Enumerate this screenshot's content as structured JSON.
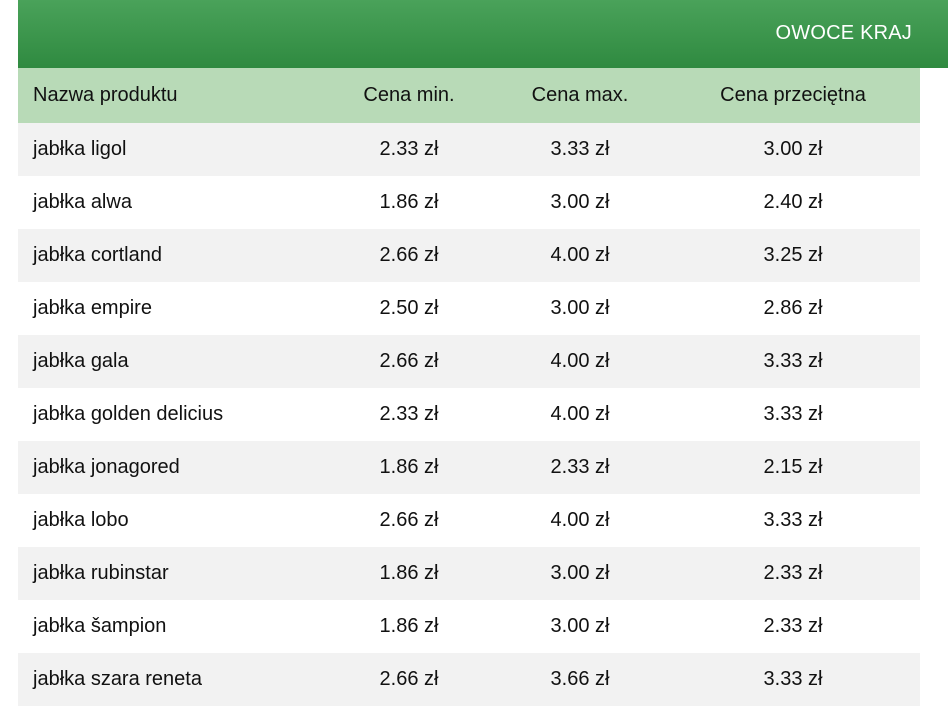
{
  "banner": {
    "title": "OWOCE KRAJ"
  },
  "table": {
    "headers": {
      "name": "Nazwa produktu",
      "min": "Cena min.",
      "max": "Cena max.",
      "avg": "Cena przeciętna"
    },
    "rows": [
      {
        "name": "jabłka ligol",
        "min": "2.33 zł",
        "max": "3.33 zł",
        "avg": "3.00 zł"
      },
      {
        "name": "jabłka alwa",
        "min": "1.86 zł",
        "max": "3.00 zł",
        "avg": "2.40 zł"
      },
      {
        "name": "jabłka cortland",
        "min": "2.66 zł",
        "max": "4.00 zł",
        "avg": "3.25 zł"
      },
      {
        "name": "jabłka empire",
        "min": "2.50 zł",
        "max": "3.00 zł",
        "avg": "2.86 zł"
      },
      {
        "name": "jabłka gala",
        "min": "2.66 zł",
        "max": "4.00 zł",
        "avg": "3.33 zł"
      },
      {
        "name": "jabłka golden delicius",
        "min": "2.33 zł",
        "max": "4.00 zł",
        "avg": "3.33 zł"
      },
      {
        "name": "jabłka jonagored",
        "min": "1.86 zł",
        "max": "2.33 zł",
        "avg": "2.15 zł"
      },
      {
        "name": "jabłka lobo",
        "min": "2.66 zł",
        "max": "4.00 zł",
        "avg": "3.33 zł"
      },
      {
        "name": "jabłka rubinstar",
        "min": "1.86 zł",
        "max": "3.00 zł",
        "avg": "2.33 zł"
      },
      {
        "name": "jabłka šampion",
        "min": "1.86 zł",
        "max": "3.00 zł",
        "avg": "2.33 zł"
      },
      {
        "name": "jabłka szara reneta",
        "min": "2.66 zł",
        "max": "3.66 zł",
        "avg": "3.33 zł"
      }
    ]
  },
  "colors": {
    "banner_top": "#4aa25a",
    "banner_bottom": "#2f8a40",
    "header_row": "#b8dab7",
    "stripe": "#f2f2f2"
  }
}
